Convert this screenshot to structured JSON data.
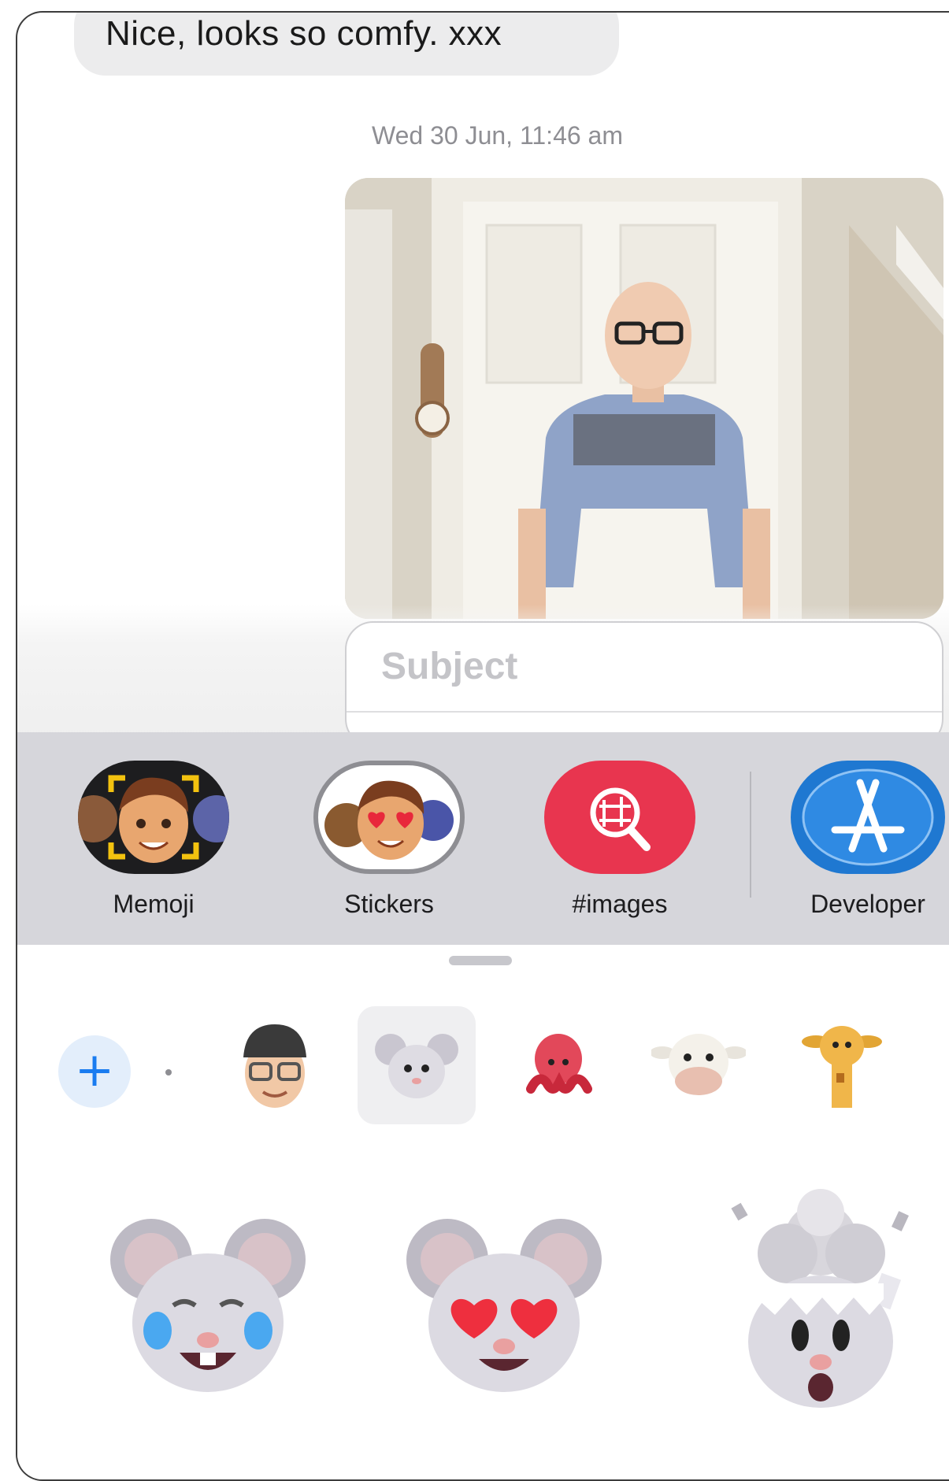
{
  "conversation": {
    "received_message": "Nice, looks so comfy. xxx",
    "timestamp": "Wed 30 Jun, 11:46 am"
  },
  "compose": {
    "subject_placeholder": "Subject"
  },
  "app_drawer": {
    "apps": [
      {
        "label": "Memoji",
        "icon": "memoji-app-icon"
      },
      {
        "label": "Stickers",
        "icon": "stickers-app-icon",
        "selected": true
      },
      {
        "label": "#images",
        "icon": "images-app-icon"
      },
      {
        "label": "Developer",
        "icon": "developer-app-icon"
      }
    ]
  },
  "sticker_panel": {
    "add_button": "+",
    "tray": [
      "memoji-avatar",
      "mouse",
      "octopus",
      "cow",
      "giraffe"
    ],
    "selected_tray": "mouse",
    "stickers": [
      "mouse-crying-laughing-sticker",
      "mouse-heart-eyes-sticker",
      "mouse-mind-blown-sticker"
    ]
  },
  "colors": {
    "images_app": "#e8354f",
    "developer_app": "#1f78d1",
    "add_button": "#1a7cf0"
  }
}
